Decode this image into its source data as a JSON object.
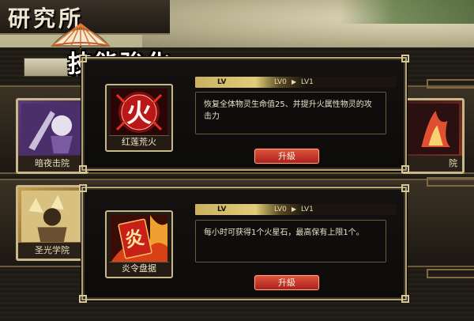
{
  "background": {
    "title": "研究所",
    "side_cards": [
      {
        "label": "暗夜击院"
      },
      {
        "label": "圣光学院"
      },
      {
        "label": "院"
      }
    ]
  },
  "header": {
    "title": "技能強化"
  },
  "skills": [
    {
      "icon_glyph": "火",
      "name": "红莲荒火",
      "lv_label": "LV",
      "lv_from": "LV0",
      "lv_to": "LV1",
      "description": "恢复全体物灵生命值25、并提升火属性物灵的攻击力",
      "button_label": "升級"
    },
    {
      "icon_glyph": "炎",
      "name": "炎令盘据",
      "lv_label": "LV",
      "lv_from": "LV0",
      "lv_to": "LV1",
      "description": "每小时可获得1个火星石，最高保有上限1个。",
      "button_label": "升級"
    }
  ],
  "colors": {
    "frame_gold": "#b7a778",
    "button_red": "#c0392b",
    "text_cream": "#e9e1cc"
  }
}
